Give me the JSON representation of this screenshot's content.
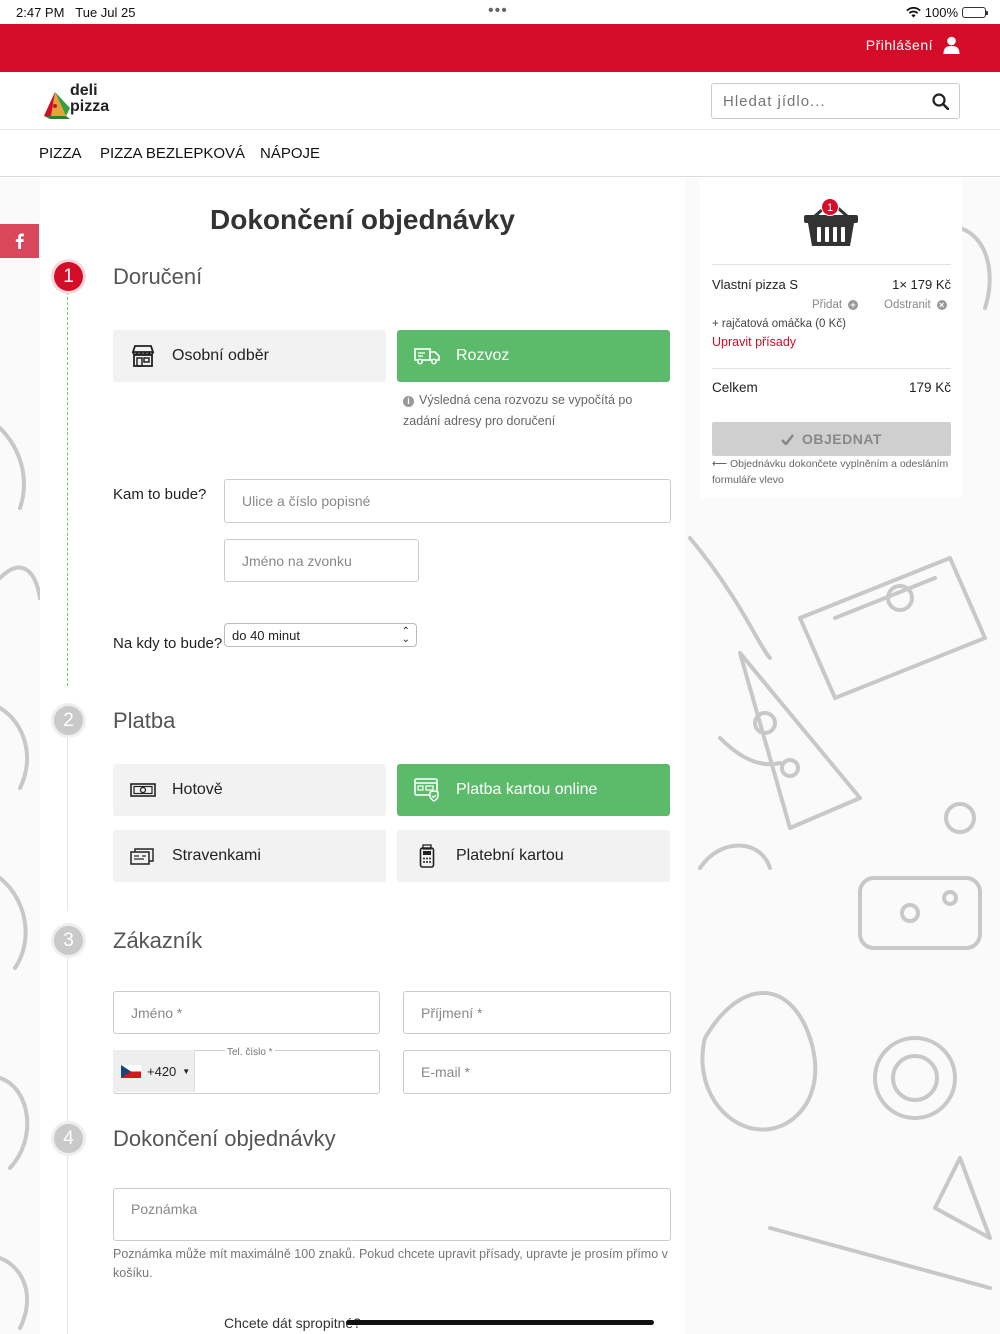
{
  "status_bar": {
    "time": "2:47 PM",
    "date": "Tue Jul 25",
    "battery": "100%"
  },
  "topbar": {
    "login_label": "Přihlášení",
    "login_icon": "user-icon"
  },
  "header": {
    "logo_line1": "deli",
    "logo_line2": "pizza",
    "search_placeholder": "Hledat jídlo..."
  },
  "nav": {
    "items": [
      "PIZZA",
      "PIZZA BEZLEPKOVÁ",
      "NÁPOJE"
    ]
  },
  "page": {
    "title": "Dokončení objednávky"
  },
  "steps": [
    {
      "num": "1",
      "title": "Doručení"
    },
    {
      "num": "2",
      "title": "Platba"
    },
    {
      "num": "3",
      "title": "Zákazník"
    },
    {
      "num": "4",
      "title": "Dokončení objednávky"
    }
  ],
  "delivery": {
    "options": [
      "Osobní odběr",
      "Rozvoz"
    ],
    "selected": "Rozvoz",
    "info": "Výsledná cena rozvozu se vypočítá po zadání adresy pro doručení",
    "where_label": "Kam to bude?",
    "street_placeholder": "Ulice a číslo popisné",
    "bell_placeholder": "Jméno na zvonku",
    "when_label": "Na kdy to bude?",
    "when_value": "do 40 minut"
  },
  "payment": {
    "options": [
      "Hotově",
      "Platba kartou online",
      "Stravenkami",
      "Platební kartou"
    ],
    "selected": "Platba kartou online"
  },
  "customer": {
    "first_name": "Jméno *",
    "last_name": "Příjmení *",
    "phone_label": "Tel. číslo *",
    "phone_prefix": "+420",
    "email": "E-mail *"
  },
  "finish": {
    "note_placeholder": "Poznámka",
    "note_help": "Poznámka může mít maximálně 100 znaků. Pokud chcete upravit přísady, upravte je prosím přímo v košíku.",
    "tip_question": "Chcete dát spropitné?"
  },
  "cart": {
    "count": "1",
    "item_name": "Vlastní pizza S",
    "item_qty_price": "1× 179 Kč",
    "add_label": "Přidat",
    "remove_label": "Odstranit",
    "topping": "+ rajčatová omáčka (0 Kč)",
    "edit_label": "Upravit přísady",
    "total_label": "Celkem",
    "total_value": "179 Kč",
    "order_button": "OBJEDNAT",
    "order_hint": "⟵ Objednávku dokončete vyplněním a odesláním formuláře vlevo"
  },
  "colors": {
    "brand_red": "#d50c27",
    "selected_green": "#5cbb6a",
    "facebook_pink": "#d9475c"
  }
}
